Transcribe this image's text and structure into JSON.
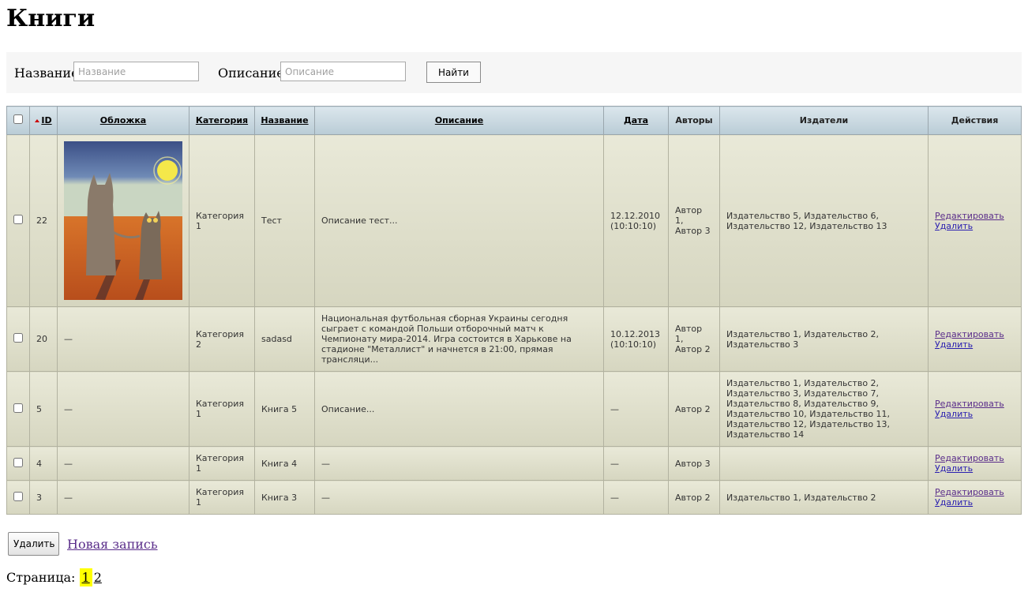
{
  "page": {
    "title": "Книги"
  },
  "filter": {
    "name_label": "Название:",
    "name_placeholder": "Название",
    "desc_label": "Описание:",
    "desc_placeholder": "Описание",
    "search_button": "Найти"
  },
  "table": {
    "headers": {
      "id": "ID",
      "cover": "Обложка",
      "category": "Категория",
      "name": "Название",
      "description": "Описание",
      "date": "Дата",
      "authors": "Авторы",
      "publishers": "Издатели",
      "actions": "Действия"
    },
    "edit_label": "Редактировать",
    "delete_label": "Удалить",
    "rows": [
      {
        "id": "22",
        "cover": "",
        "category": "Категория 1",
        "name": "Тест",
        "description": "Описание тест...",
        "date": "12.12.2010 (10:10:10)",
        "authors": "Автор 1, Автор 3",
        "publishers": "Издательство 5, Издательство 6, Издательство 12, Издательство 13"
      },
      {
        "id": "20",
        "cover": "—",
        "category": "Категория 2",
        "name": "sadasd",
        "description": "Национальная футбольная сборная Украины сегодня сыграет с командой Польши отборочный матч к Чемпионату мира-2014. Игра состоится в Харькове на стадионе \"Металлист\" и начнется в 21:00, прямая трансляци...",
        "date": "10.12.2013 (10:10:10)",
        "authors": "Автор 1, Автор 2",
        "publishers": "Издательство 1, Издательство 2, Издательство 3"
      },
      {
        "id": "5",
        "cover": "—",
        "category": "Категория 1",
        "name": "Книга 5",
        "description": "Описание...",
        "date": "—",
        "authors": "Автор 2",
        "publishers": "Издательство 1, Издательство 2, Издательство 3, Издательство 7, Издательство 8, Издательство 9, Издательство 10, Издательство 11, Издательство 12, Издательство 13, Издательство 14"
      },
      {
        "id": "4",
        "cover": "—",
        "category": "Категория 1",
        "name": "Книга 4",
        "description": "—",
        "date": "—",
        "authors": "Автор 3",
        "publishers": ""
      },
      {
        "id": "3",
        "cover": "—",
        "category": "Категория 1",
        "name": "Книга 3",
        "description": "—",
        "date": "—",
        "authors": "Автор 2",
        "publishers": "Издательство 1, Издательство 2"
      }
    ]
  },
  "bottom": {
    "delete_button": "Удалить",
    "new_record_link": "Новая запись"
  },
  "pager": {
    "label": "Страница:",
    "current": "1",
    "pages": [
      "2"
    ]
  },
  "colors": {
    "header_bg": "#c8d8e0",
    "row_bg": "#e0e0cc",
    "current_page": "#ffff00"
  }
}
